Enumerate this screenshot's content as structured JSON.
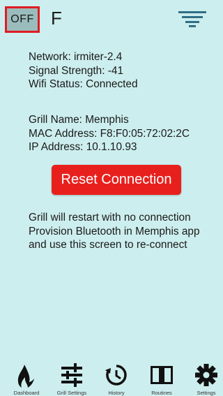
{
  "header": {
    "power_label": "OFF",
    "unit_label": "F",
    "menu_icon": "filter-menu-icon"
  },
  "network": {
    "network_line": "Network: irmiter-2.4",
    "signal_line": "Signal Strength: -41",
    "wifi_status_line": "Wifi Status: Connected"
  },
  "grill": {
    "name_line": "Grill Name: Memphis",
    "mac_line": "MAC Address: F8:F0:05:72:02:2C",
    "ip_line": "IP Address: 10.1.10.93"
  },
  "reset_button_label": "Reset Connection",
  "instructions": [
    "Grill will restart with no connection",
    "Provision Bluetooth in Memphis app",
    "and use this screen to re-connect"
  ],
  "tabs": [
    {
      "label": "Dashboard",
      "icon": "flame-icon"
    },
    {
      "label": "Grill Settings",
      "icon": "sliders-icon"
    },
    {
      "label": "History",
      "icon": "history-icon"
    },
    {
      "label": "Routines",
      "icon": "book-icon"
    },
    {
      "label": "Settings",
      "icon": "gear-icon"
    }
  ],
  "colors": {
    "background": "#cdeeee",
    "accent_red": "#e8201d",
    "off_button_bg": "#9bbcbc"
  }
}
